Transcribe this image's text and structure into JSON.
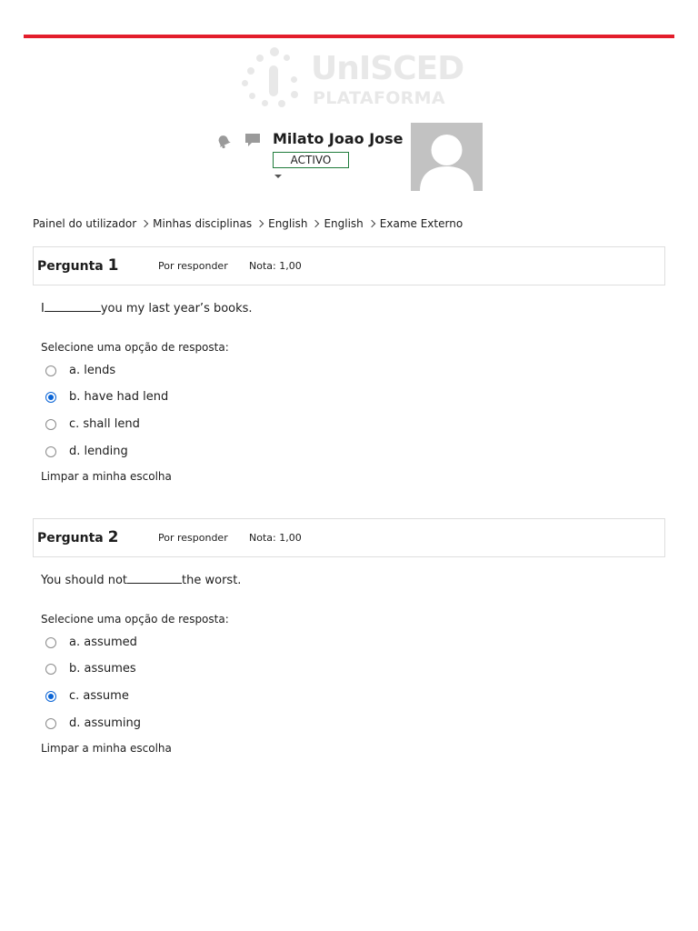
{
  "brand": {
    "name": "UnISCED",
    "subtitle": "PLATAFORMA",
    "accent_color": "#e31d2b"
  },
  "header": {
    "icons": [
      "bell-icon",
      "chat-icon"
    ],
    "user_name": "Milato Joao Jose",
    "status": "ACTIVO",
    "status_color": "#1e7b3a"
  },
  "breadcrumb": [
    "Painel do utilizador",
    "Minhas disciplinas",
    "English",
    "English",
    "Exame Externo"
  ],
  "questions": [
    {
      "title": "Pergunta",
      "number": "1",
      "state": "Por responder",
      "grade": "Nota: 1,00",
      "text_before": "I",
      "text_after": "you my last year’s books.",
      "prompt": "Selecione uma opção de resposta:",
      "options": [
        "a. lends",
        "b. have had lend",
        "c. shall lend",
        "d. lending"
      ],
      "selected": 1,
      "clear": "Limpar a minha escolha"
    },
    {
      "title": "Pergunta",
      "number": "2",
      "state": "Por responder",
      "grade": "Nota: 1,00",
      "text_before": "You should not",
      "text_after": "the worst.",
      "prompt": "Selecione uma opção de resposta:",
      "options": [
        "a. assumed",
        "b. assumes",
        "c. assume",
        "d. assuming"
      ],
      "selected": 2,
      "clear": "Limpar a minha escolha"
    }
  ]
}
